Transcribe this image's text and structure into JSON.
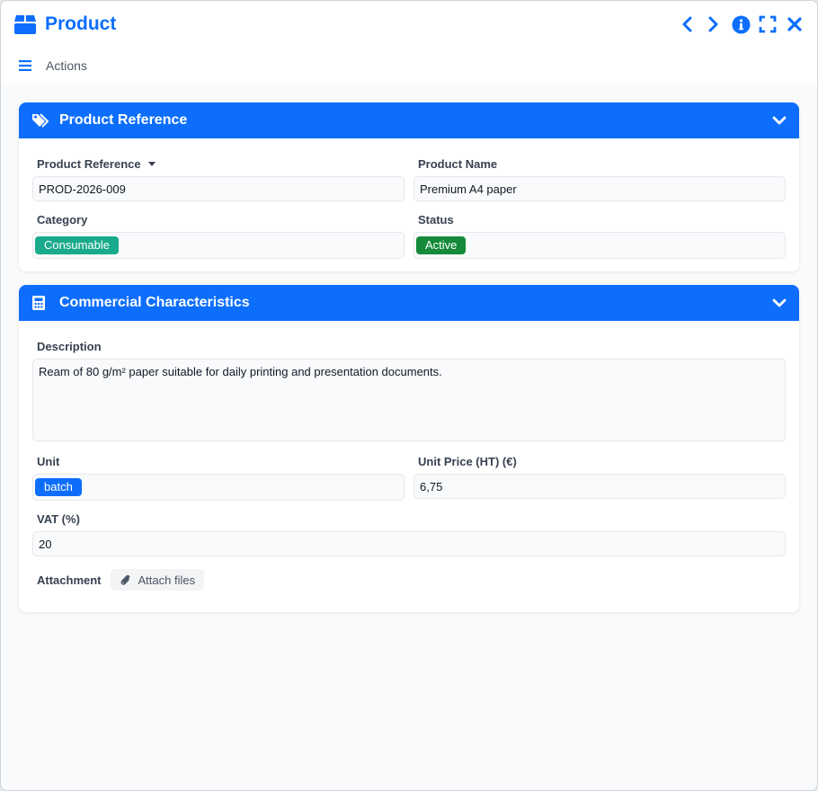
{
  "window": {
    "title": "Product"
  },
  "toolbar": {
    "actions_label": "Actions"
  },
  "colors": {
    "accent": "#0d6efd",
    "consumable": "#1aaa8c",
    "active": "#148a3a",
    "batch": "#0d6efd"
  },
  "section_reference": {
    "title": "Product Reference",
    "product_reference": {
      "label": "Product Reference",
      "value": "PROD-2026-009"
    },
    "product_name": {
      "label": "Product Name",
      "value": "Premium A4 paper"
    },
    "category": {
      "label": "Category",
      "value": "Consumable"
    },
    "status": {
      "label": "Status",
      "value": "Active"
    }
  },
  "section_commercial": {
    "title": "Commercial Characteristics",
    "description": {
      "label": "Description",
      "value": "Ream of 80 g/m² paper suitable for daily printing and presentation documents."
    },
    "unit": {
      "label": "Unit",
      "value": "batch"
    },
    "unit_price": {
      "label": "Unit Price (HT) (€)",
      "value": "6,75"
    },
    "vat": {
      "label": "VAT (%)",
      "value": "20"
    },
    "attachment": {
      "label": "Attachment",
      "button_label": "Attach files"
    }
  }
}
